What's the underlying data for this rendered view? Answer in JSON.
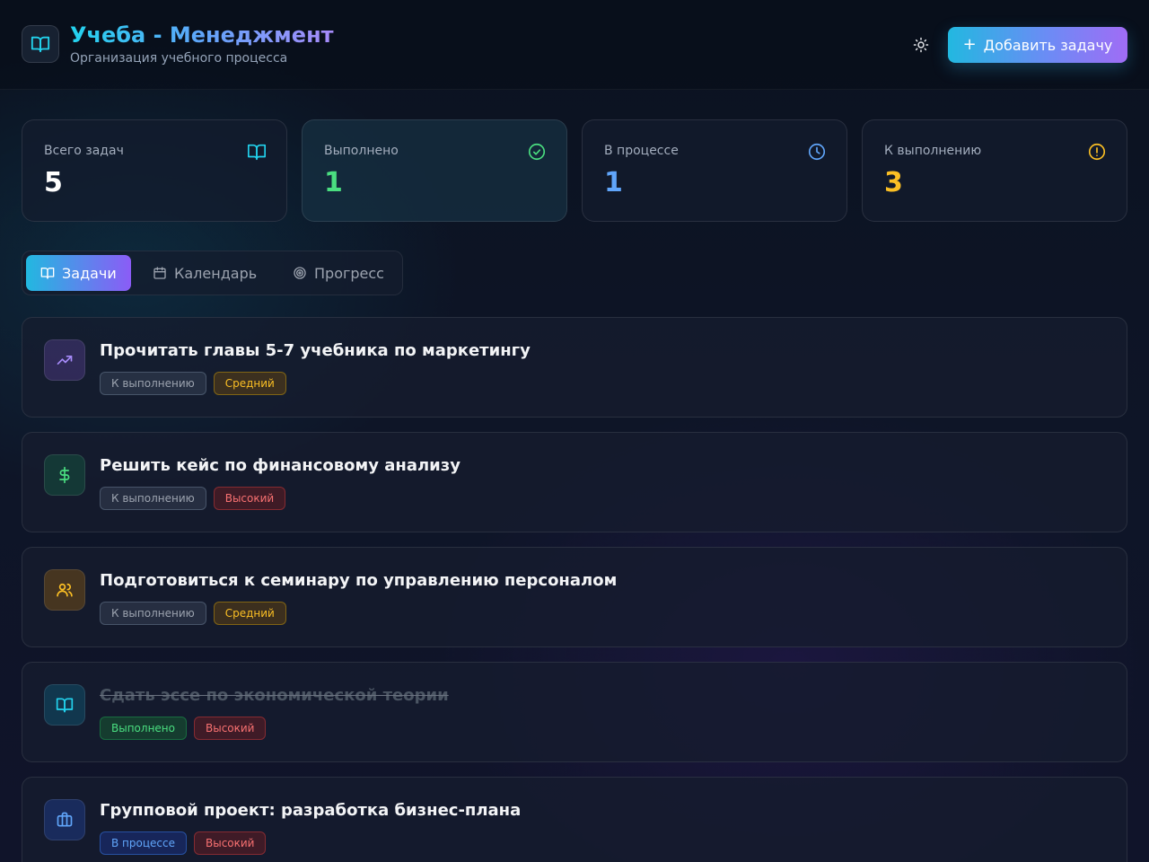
{
  "header": {
    "title": "Учеба - Менеджмент",
    "subtitle": "Организация учебного процесса",
    "add_task_label": "Добавить задачу"
  },
  "stats": [
    {
      "label": "Всего задач",
      "value": "5",
      "icon": "book-icon",
      "color": "#ffffff",
      "icon_color": "#22d3ee"
    },
    {
      "label": "Выполнено",
      "value": "1",
      "icon": "check-circle-icon",
      "color": "#4ade80",
      "icon_color": "#4ade80"
    },
    {
      "label": "В процессе",
      "value": "1",
      "icon": "clock-icon",
      "color": "#60a5fa",
      "icon_color": "#60a5fa"
    },
    {
      "label": "К выполнению",
      "value": "3",
      "icon": "alert-circle-icon",
      "color": "#fbbf24",
      "icon_color": "#fbbf24"
    }
  ],
  "tabs": [
    {
      "label": "Задачи",
      "icon": "book-icon",
      "active": true
    },
    {
      "label": "Календарь",
      "icon": "calendar-icon",
      "active": false
    },
    {
      "label": "Прогресс",
      "icon": "target-icon",
      "active": false
    }
  ],
  "tasks": [
    {
      "title": "Прочитать главы 5-7 учебника по маркетингу",
      "status": "К выполнению",
      "priority": "Средний",
      "icon": "trending-up-icon",
      "done": false
    },
    {
      "title": "Решить кейс по финансовому анализу",
      "status": "К выполнению",
      "priority": "Высокий",
      "icon": "dollar-icon",
      "done": false
    },
    {
      "title": "Подготовиться к семинару по управлению персоналом",
      "status": "К выполнению",
      "priority": "Средний",
      "icon": "users-icon",
      "done": false
    },
    {
      "title": "Сдать эссе по экономической теории",
      "status": "Выполнено",
      "priority": "Высокий",
      "icon": "book-icon",
      "done": true
    },
    {
      "title": "Групповой проект: разработка бизнес-плана",
      "status": "В процессе",
      "priority": "Высокий",
      "icon": "briefcase-icon",
      "done": false
    }
  ],
  "colors": {
    "accent_cyan": "#22d3ee",
    "accent_violet": "#8b5cf6",
    "background": "#0e1527"
  }
}
